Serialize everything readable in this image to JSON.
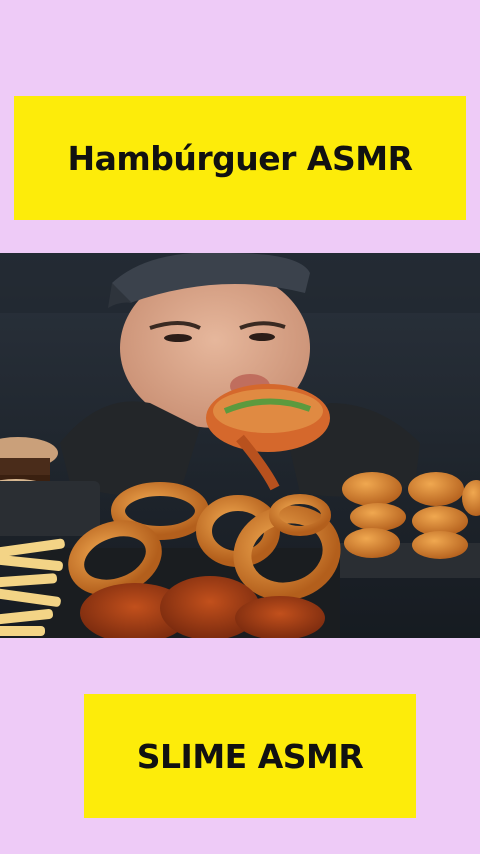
{
  "top_label": {
    "text": "Hambúrguer ASMR"
  },
  "bottom_label": {
    "text": "SLIME ASMR"
  },
  "video": {
    "subject": "mukbang-person-eating-burger-onion-rings-nuggets-fries"
  },
  "colors": {
    "page_background": "#eecbf7",
    "label_background": "#fdec0a",
    "label_text": "#111111",
    "video_background": "#1d242d"
  }
}
